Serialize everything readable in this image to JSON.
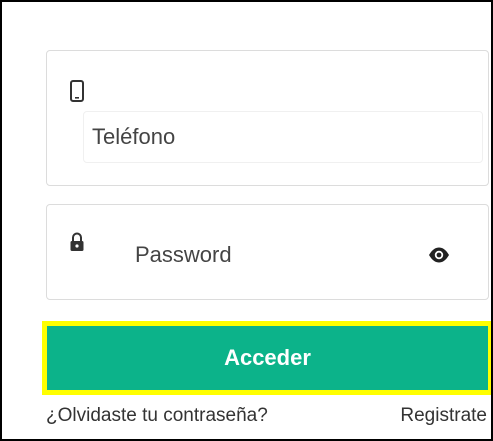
{
  "form": {
    "phone_icon": "smartphone-icon",
    "phone_placeholder": "Teléfono",
    "phone_value": "",
    "password_icon": "lock-icon",
    "password_placeholder": "Password",
    "password_value": "",
    "visibility_icon": "eye-icon"
  },
  "actions": {
    "login_label": "Acceder",
    "forgot_label": "¿Olvidaste tu contraseña?",
    "register_label": "Registrate"
  },
  "colors": {
    "button_bg": "#0cb38a",
    "button_highlight": "#ffff00",
    "card_border": "#dcdcdc",
    "text": "#333333"
  }
}
